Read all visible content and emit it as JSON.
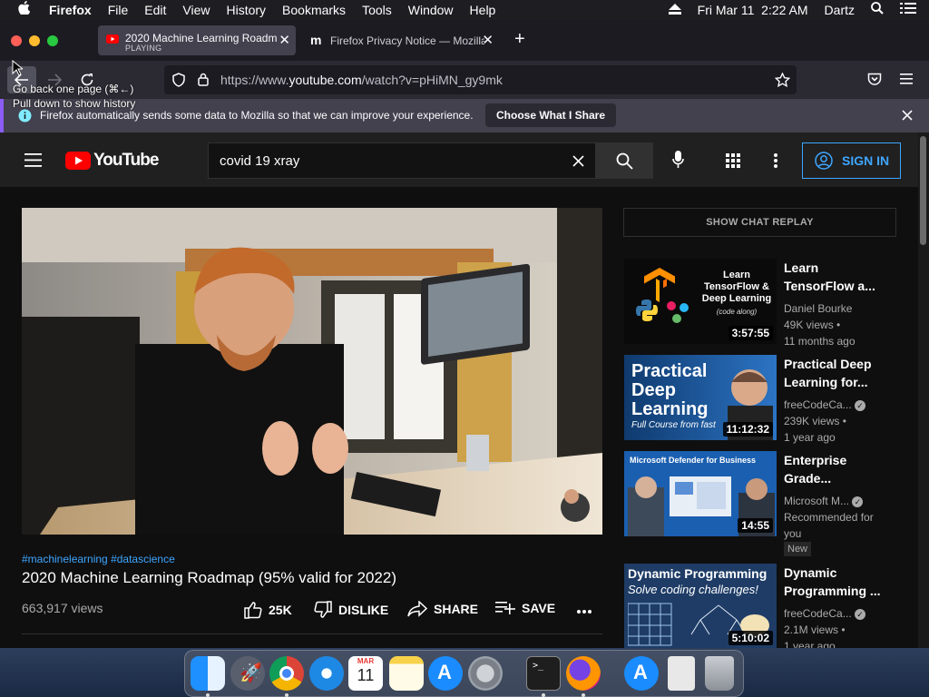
{
  "menubar": {
    "apple": "",
    "app": "Firefox",
    "items": [
      "File",
      "Edit",
      "View",
      "History",
      "Bookmarks",
      "Tools",
      "Window",
      "Help"
    ],
    "datetime": "Fri Mar 11  2:22 AM",
    "user": "Dartz"
  },
  "tabs": [
    {
      "title": "2020 Machine Learning Roadma",
      "status": "PLAYING",
      "favicon": "youtube-icon"
    },
    {
      "title": "Firefox Privacy Notice — Mozilla",
      "status": "",
      "favicon": "mozilla-icon"
    }
  ],
  "tooltip": {
    "line1": "Go back one page (⌘←)",
    "line2": "Pull down to show history"
  },
  "urlbar": {
    "prefix": "https://www.",
    "domain": "youtube.com",
    "path": "/watch?v=pHiMN_gy9mk"
  },
  "notification": {
    "message": "Firefox automatically sends some data to Mozilla so that we can improve your experience.",
    "button": "Choose What I Share"
  },
  "youtube": {
    "logo_text": "YouTube",
    "search_value": "covid 19 xray",
    "signin_label": "SIGN IN",
    "hashtags": "#machinelearning #datascience",
    "title": "2020 Machine Learning Roadmap (95% valid for 2022)",
    "views": "663,917 views",
    "likes": "25K",
    "dislike": "DISLIKE",
    "share": "SHARE",
    "save": "SAVE",
    "chat_replay": "SHOW CHAT REPLAY",
    "recommendations": [
      {
        "title": "Learn TensorFlow a...",
        "channel": "Daniel Bourke",
        "views": "49K views",
        "age": "11 months ago",
        "duration": "3:57:55",
        "verified": false,
        "thumb_text": "Learn TensorFlow & Deep Learning",
        "thumb_sub": "(code along)",
        "badge": ""
      },
      {
        "title": "Practical Deep Learning for...",
        "channel": "freeCodeCa...",
        "views": "239K views",
        "age": "1 year ago",
        "duration": "11:12:32",
        "verified": true,
        "thumb_text": "Practical Deep Learning",
        "thumb_sub": "Full Course from fast",
        "badge": ""
      },
      {
        "title": "Enterprise Grade...",
        "channel": "Microsoft M...",
        "views": "Recommended for you",
        "age": "",
        "duration": "14:55",
        "verified": true,
        "thumb_text": "Microsoft Defender for Business",
        "thumb_sub": "",
        "badge": "New"
      },
      {
        "title": "Dynamic Programming ...",
        "channel": "freeCodeCa...",
        "views": "2.1M views",
        "age": "1 year ago",
        "duration": "5:10:02",
        "verified": true,
        "thumb_text": "Dynamic Programming",
        "thumb_sub": "Solve coding challenges!",
        "badge": ""
      }
    ]
  },
  "dock": [
    "finder",
    "launchpad",
    "chrome",
    "safari",
    "calendar",
    "notes",
    "app-store",
    "system-preferences",
    "terminal",
    "firefox",
    "app-store-2",
    "preview",
    "trash"
  ],
  "dock_calendar": {
    "month": "MAR",
    "day": "11"
  },
  "colors": {
    "youtube_red": "#ff0000",
    "link_blue": "#3ea6ff",
    "firefox_purple": "#8b5cf6"
  }
}
